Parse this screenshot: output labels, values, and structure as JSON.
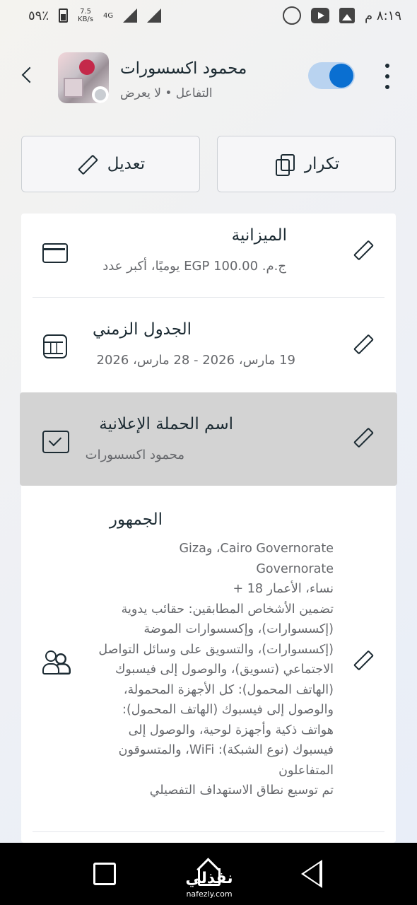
{
  "status_bar": {
    "battery_text": "٥٩٪",
    "speed_value": "7.5",
    "speed_unit": "KB/s",
    "network": "4G",
    "time": "٨:١٩ م"
  },
  "header": {
    "page_name": "محمود اكسسورات",
    "subtitle": "التفاعل • لا يعرض",
    "toggle_on": true
  },
  "actions": {
    "duplicate_label": "تكرار",
    "edit_label": "تعديل"
  },
  "rows": {
    "budget": {
      "title": "الميزانية",
      "sub": "ج.م. EGP 100.00 يوميًا، أكبر عدد"
    },
    "schedule": {
      "title": "الجدول الزمني",
      "sub": "19 مارس، 2026 - 28 مارس، 2026"
    },
    "campaign": {
      "title": "اسم الحملة الإعلانية",
      "sub": "محمود اكسسورات"
    },
    "audience": {
      "title": "الجمهور",
      "lines": [
        "Cairo Governorate، وGiza",
        "Governorate",
        "نساء، الأعمار 18 +",
        "تضمين الأشخاص المطابقين: حقائب يدوية",
        "(إكسسوارات)، وإكسسوارات الموضة",
        "(إكسسوارات)، والتسويق على وسائل التواصل",
        "الاجتماعي (تسويق)، والوصول إلى فيسبوك",
        "(الهاتف المحمول): كل الأجهزة المحمولة،",
        "والوصول إلى فيسبوك (الهاتف المحمول):",
        "هواتف ذكية وأجهزة لوحية، والوصول إلى",
        "فيسبوك (نوع الشبكة): WiFi، والمتسوقون",
        "المتفاعلون",
        "تم توسيع نطاق الاستهداف التفصيلي"
      ]
    }
  },
  "watermark": {
    "brand": "نفذلي",
    "url": "nafezly.com"
  },
  "colors": {
    "accent": "#0a6fd1",
    "toggle_track": "#b9d3f0",
    "highlight": "#d3d3d3"
  }
}
